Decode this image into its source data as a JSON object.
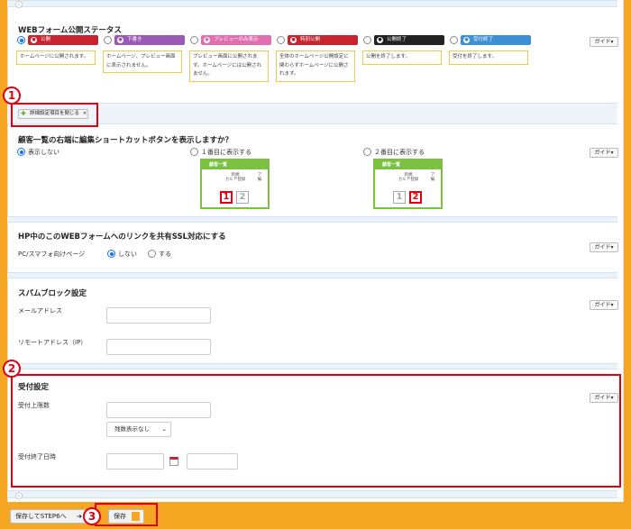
{
  "status": {
    "title": "WEBフォーム公開ステータス",
    "guide": "ガイド",
    "options": [
      {
        "label": "公開",
        "color": "#c9252f",
        "icon": "globe-icon",
        "note": "ホームページに公開されます。"
      },
      {
        "label": "下書き",
        "color": "#9b59b6",
        "icon": "pencil-icon",
        "note": "ホームページ、プレビュー画面に表示されません。"
      },
      {
        "label": "プレビューのみ表示",
        "color": "#e26fb0",
        "icon": "preview-icon",
        "note": "プレビュー画面に公開されます。ホームページには公開されません。"
      },
      {
        "label": "特別公開",
        "color": "#c9252f",
        "icon": "star-icon",
        "note": "全体のホームページ公開設定に関わらずホームページに公開されます。"
      },
      {
        "label": "公開終了",
        "color": "#222222",
        "icon": "stop-icon",
        "note": "公開を終了します。"
      },
      {
        "label": "受付終了",
        "color": "#3d8fd6",
        "icon": "mail-icon",
        "note": "受付を終了します。"
      }
    ]
  },
  "collapse_toggle": {
    "label": "詳細設定項目を閉じる",
    "close_glyph": "×"
  },
  "shortcut": {
    "title": "顧客一覧の右端に編集ショートカットボタンを表示しますか？",
    "guide": "ガイド",
    "options": [
      "表示しない",
      "１番目に表示する",
      "２番目に表示する"
    ],
    "thumb_header": "顧客一覧",
    "thumb_btn": "新規\nカルテ登録",
    "thumb_btn2": "ア\n編",
    "n1": "1",
    "n2": "2"
  },
  "ssl": {
    "title": "HP中のこのWEBフォームへのリンクを共有SSL対応にする",
    "guide": "ガイド",
    "field_label": "PC/スマフォ向けページ",
    "options": [
      "しない",
      "する"
    ]
  },
  "spam": {
    "title": "スパムブロック設定",
    "guide": "ガイド",
    "email_label": "メールアドレス",
    "remote_label": "リモートアドレス（IP）"
  },
  "reception": {
    "title": "受付設定",
    "guide": "ガイド",
    "limit_label": "受付上限数",
    "select_value": "残数表示なし",
    "end_label": "受付終了日時"
  },
  "callouts": [
    "1",
    "2",
    "3"
  ],
  "footer": {
    "save_next": "保存してSTEP6へ",
    "save": "保存"
  }
}
